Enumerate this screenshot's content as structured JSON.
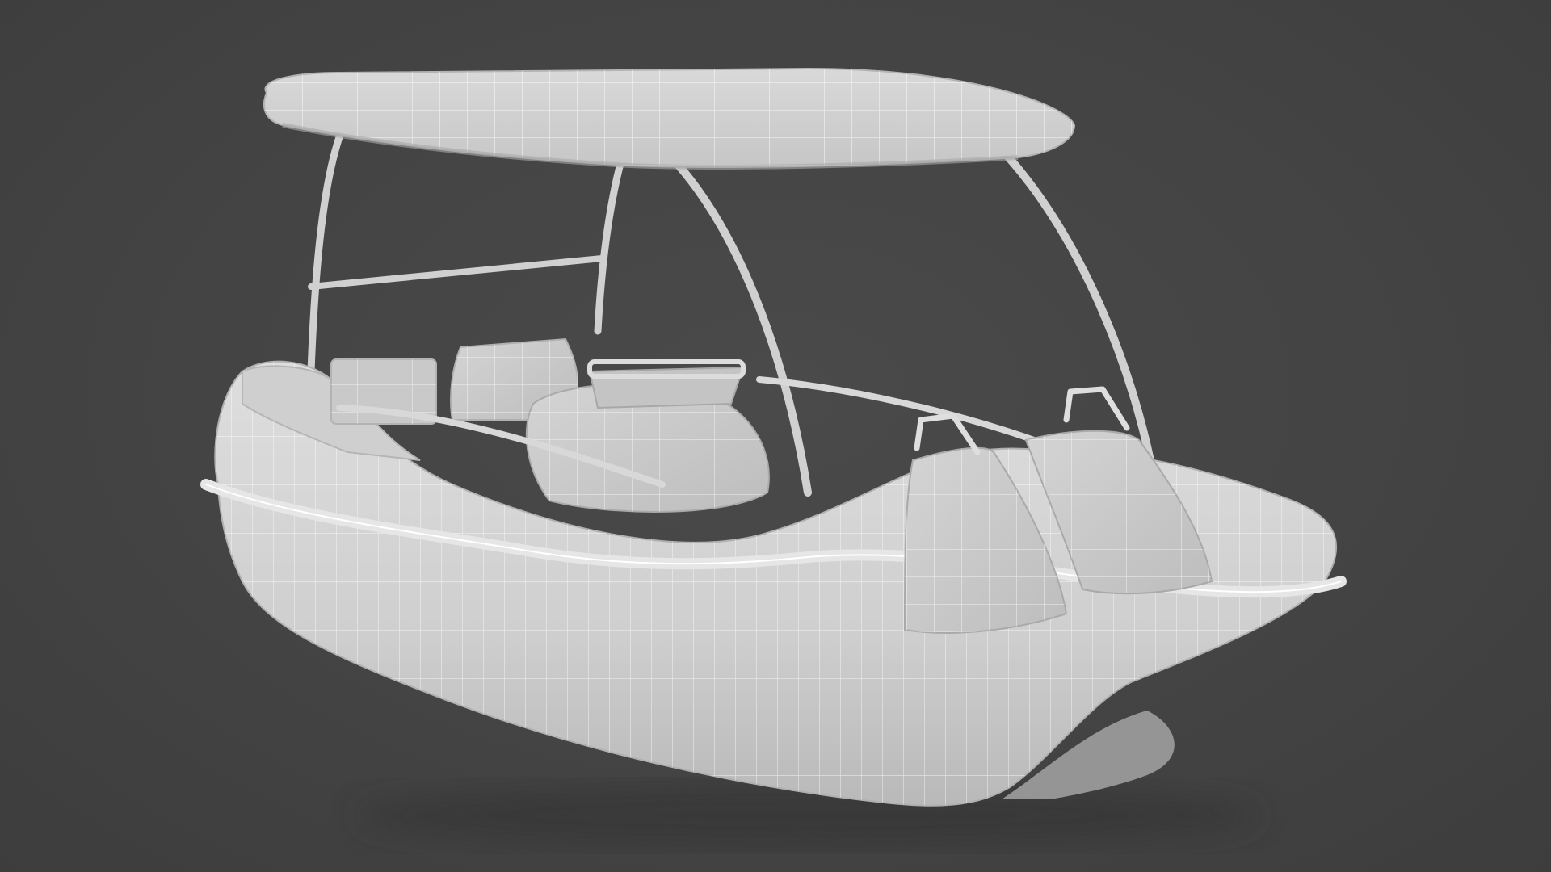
{
  "render": {
    "background_color": "#444444",
    "model_color": "#d6d6d6",
    "model_shadow_color": "#a9a9a9",
    "wire_color": "#ffffff"
  },
  "model": {
    "subject": "pedal-boat-wireframe",
    "parts": [
      "canopy-roof",
      "canopy-frame",
      "hull",
      "seats",
      "steering-console",
      "side-rails",
      "grab-handles",
      "twin-pontoons"
    ]
  }
}
